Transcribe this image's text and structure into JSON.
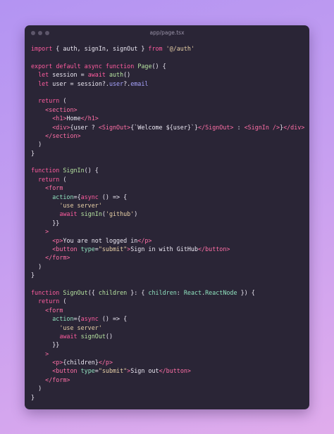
{
  "window": {
    "title": "app/page.tsx",
    "colors": {
      "background": "#2a2536",
      "keyword": "#ff5c9f",
      "function": "#b6e3a0",
      "string": "#e8d0a6",
      "tag": "#ff6fa6",
      "attribute": "#8fe0bd",
      "property": "#a8a4ff",
      "plain": "#ece8f3"
    }
  },
  "code": {
    "lines": [
      [
        {
          "t": "import",
          "c": "kw"
        },
        {
          "t": " { auth, signIn, signOut } ",
          "c": "pl"
        },
        {
          "t": "from",
          "c": "kw"
        },
        {
          "t": " ",
          "c": "pl"
        },
        {
          "t": "'@/auth'",
          "c": "str"
        }
      ],
      [],
      [
        {
          "t": "export",
          "c": "kw"
        },
        {
          "t": " ",
          "c": "pl"
        },
        {
          "t": "default",
          "c": "kw"
        },
        {
          "t": " ",
          "c": "pl"
        },
        {
          "t": "async",
          "c": "kw"
        },
        {
          "t": " ",
          "c": "pl"
        },
        {
          "t": "function",
          "c": "kw"
        },
        {
          "t": " ",
          "c": "pl"
        },
        {
          "t": "Page",
          "c": "fn"
        },
        {
          "t": "() {",
          "c": "pl"
        }
      ],
      [
        {
          "t": "  ",
          "c": "pl"
        },
        {
          "t": "let",
          "c": "kw"
        },
        {
          "t": " session = ",
          "c": "pl"
        },
        {
          "t": "await",
          "c": "kw"
        },
        {
          "t": " ",
          "c": "pl"
        },
        {
          "t": "auth",
          "c": "fn"
        },
        {
          "t": "()",
          "c": "pl"
        }
      ],
      [
        {
          "t": "  ",
          "c": "pl"
        },
        {
          "t": "let",
          "c": "kw"
        },
        {
          "t": " user = session?.",
          "c": "pl"
        },
        {
          "t": "user",
          "c": "prop"
        },
        {
          "t": "?.",
          "c": "pl"
        },
        {
          "t": "email",
          "c": "prop"
        }
      ],
      [],
      [
        {
          "t": "  ",
          "c": "pl"
        },
        {
          "t": "return",
          "c": "kw"
        },
        {
          "t": " (",
          "c": "pl"
        }
      ],
      [
        {
          "t": "    ",
          "c": "pl"
        },
        {
          "t": "<section>",
          "c": "tag"
        }
      ],
      [
        {
          "t": "      ",
          "c": "pl"
        },
        {
          "t": "<h1>",
          "c": "tag"
        },
        {
          "t": "Home",
          "c": "pl"
        },
        {
          "t": "</h1>",
          "c": "tag"
        }
      ],
      [
        {
          "t": "      ",
          "c": "pl"
        },
        {
          "t": "<div>",
          "c": "tag"
        },
        {
          "t": "{user ? ",
          "c": "pl"
        },
        {
          "t": "<SignOut>",
          "c": "comp"
        },
        {
          "t": "{`Welcome ${user}`}",
          "c": "pl"
        },
        {
          "t": "</SignOut>",
          "c": "comp"
        },
        {
          "t": " : ",
          "c": "pl"
        },
        {
          "t": "<SignIn />",
          "c": "comp"
        },
        {
          "t": "}",
          "c": "pl"
        },
        {
          "t": "</div>",
          "c": "tag"
        }
      ],
      [
        {
          "t": "    ",
          "c": "pl"
        },
        {
          "t": "</section>",
          "c": "tag"
        }
      ],
      [
        {
          "t": "  )",
          "c": "pl"
        }
      ],
      [
        {
          "t": "}",
          "c": "pl"
        }
      ],
      [],
      [
        {
          "t": "function",
          "c": "kw"
        },
        {
          "t": " ",
          "c": "pl"
        },
        {
          "t": "SignIn",
          "c": "fn"
        },
        {
          "t": "() {",
          "c": "pl"
        }
      ],
      [
        {
          "t": "  ",
          "c": "pl"
        },
        {
          "t": "return",
          "c": "kw"
        },
        {
          "t": " (",
          "c": "pl"
        }
      ],
      [
        {
          "t": "    ",
          "c": "pl"
        },
        {
          "t": "<form",
          "c": "tag"
        }
      ],
      [
        {
          "t": "      ",
          "c": "pl"
        },
        {
          "t": "action",
          "c": "attr"
        },
        {
          "t": "={",
          "c": "pl"
        },
        {
          "t": "async",
          "c": "kw"
        },
        {
          "t": " () => {",
          "c": "pl"
        }
      ],
      [
        {
          "t": "        ",
          "c": "pl"
        },
        {
          "t": "'use server'",
          "c": "str"
        }
      ],
      [
        {
          "t": "        ",
          "c": "pl"
        },
        {
          "t": "await",
          "c": "kw"
        },
        {
          "t": " ",
          "c": "pl"
        },
        {
          "t": "signIn",
          "c": "fn"
        },
        {
          "t": "(",
          "c": "pl"
        },
        {
          "t": "'github'",
          "c": "str"
        },
        {
          "t": ")",
          "c": "pl"
        }
      ],
      [
        {
          "t": "      }}",
          "c": "pl"
        }
      ],
      [
        {
          "t": "    ",
          "c": "pl"
        },
        {
          "t": ">",
          "c": "tag"
        }
      ],
      [
        {
          "t": "      ",
          "c": "pl"
        },
        {
          "t": "<p>",
          "c": "tag"
        },
        {
          "t": "You are not logged in",
          "c": "pl"
        },
        {
          "t": "</p>",
          "c": "tag"
        }
      ],
      [
        {
          "t": "      ",
          "c": "pl"
        },
        {
          "t": "<button",
          "c": "tag"
        },
        {
          "t": " ",
          "c": "pl"
        },
        {
          "t": "type",
          "c": "attr"
        },
        {
          "t": "=",
          "c": "pl"
        },
        {
          "t": "\"submit\"",
          "c": "str"
        },
        {
          "t": ">",
          "c": "tag"
        },
        {
          "t": "Sign in with GitHub",
          "c": "pl"
        },
        {
          "t": "</button>",
          "c": "tag"
        }
      ],
      [
        {
          "t": "    ",
          "c": "pl"
        },
        {
          "t": "</form>",
          "c": "tag"
        }
      ],
      [
        {
          "t": "  )",
          "c": "pl"
        }
      ],
      [
        {
          "t": "}",
          "c": "pl"
        }
      ],
      [],
      [
        {
          "t": "function",
          "c": "kw"
        },
        {
          "t": " ",
          "c": "pl"
        },
        {
          "t": "SignOut",
          "c": "fn"
        },
        {
          "t": "({ ",
          "c": "pl"
        },
        {
          "t": "children",
          "c": "fn"
        },
        {
          "t": " }: { ",
          "c": "pl"
        },
        {
          "t": "children",
          "c": "attr"
        },
        {
          "t": ": ",
          "c": "pl"
        },
        {
          "t": "React",
          "c": "attr"
        },
        {
          "t": ".",
          "c": "pl"
        },
        {
          "t": "ReactNode",
          "c": "attr"
        },
        {
          "t": " }) {",
          "c": "pl"
        }
      ],
      [
        {
          "t": "  ",
          "c": "pl"
        },
        {
          "t": "return",
          "c": "kw"
        },
        {
          "t": " (",
          "c": "pl"
        }
      ],
      [
        {
          "t": "    ",
          "c": "pl"
        },
        {
          "t": "<form",
          "c": "tag"
        }
      ],
      [
        {
          "t": "      ",
          "c": "pl"
        },
        {
          "t": "action",
          "c": "attr"
        },
        {
          "t": "={",
          "c": "pl"
        },
        {
          "t": "async",
          "c": "kw"
        },
        {
          "t": " () => {",
          "c": "pl"
        }
      ],
      [
        {
          "t": "        ",
          "c": "pl"
        },
        {
          "t": "'use server'",
          "c": "str"
        }
      ],
      [
        {
          "t": "        ",
          "c": "pl"
        },
        {
          "t": "await",
          "c": "kw"
        },
        {
          "t": " ",
          "c": "pl"
        },
        {
          "t": "signOut",
          "c": "fn"
        },
        {
          "t": "()",
          "c": "pl"
        }
      ],
      [
        {
          "t": "      }}",
          "c": "pl"
        }
      ],
      [
        {
          "t": "    ",
          "c": "pl"
        },
        {
          "t": ">",
          "c": "tag"
        }
      ],
      [
        {
          "t": "      ",
          "c": "pl"
        },
        {
          "t": "<p>",
          "c": "tag"
        },
        {
          "t": "{children}",
          "c": "pl"
        },
        {
          "t": "</p>",
          "c": "tag"
        }
      ],
      [
        {
          "t": "      ",
          "c": "pl"
        },
        {
          "t": "<button",
          "c": "tag"
        },
        {
          "t": " ",
          "c": "pl"
        },
        {
          "t": "type",
          "c": "attr"
        },
        {
          "t": "=",
          "c": "pl"
        },
        {
          "t": "\"submit\"",
          "c": "str"
        },
        {
          "t": ">",
          "c": "tag"
        },
        {
          "t": "Sign out",
          "c": "pl"
        },
        {
          "t": "</button>",
          "c": "tag"
        }
      ],
      [
        {
          "t": "    ",
          "c": "pl"
        },
        {
          "t": "</form>",
          "c": "tag"
        }
      ],
      [
        {
          "t": "  )",
          "c": "pl"
        }
      ],
      [
        {
          "t": "}",
          "c": "pl"
        }
      ]
    ]
  }
}
